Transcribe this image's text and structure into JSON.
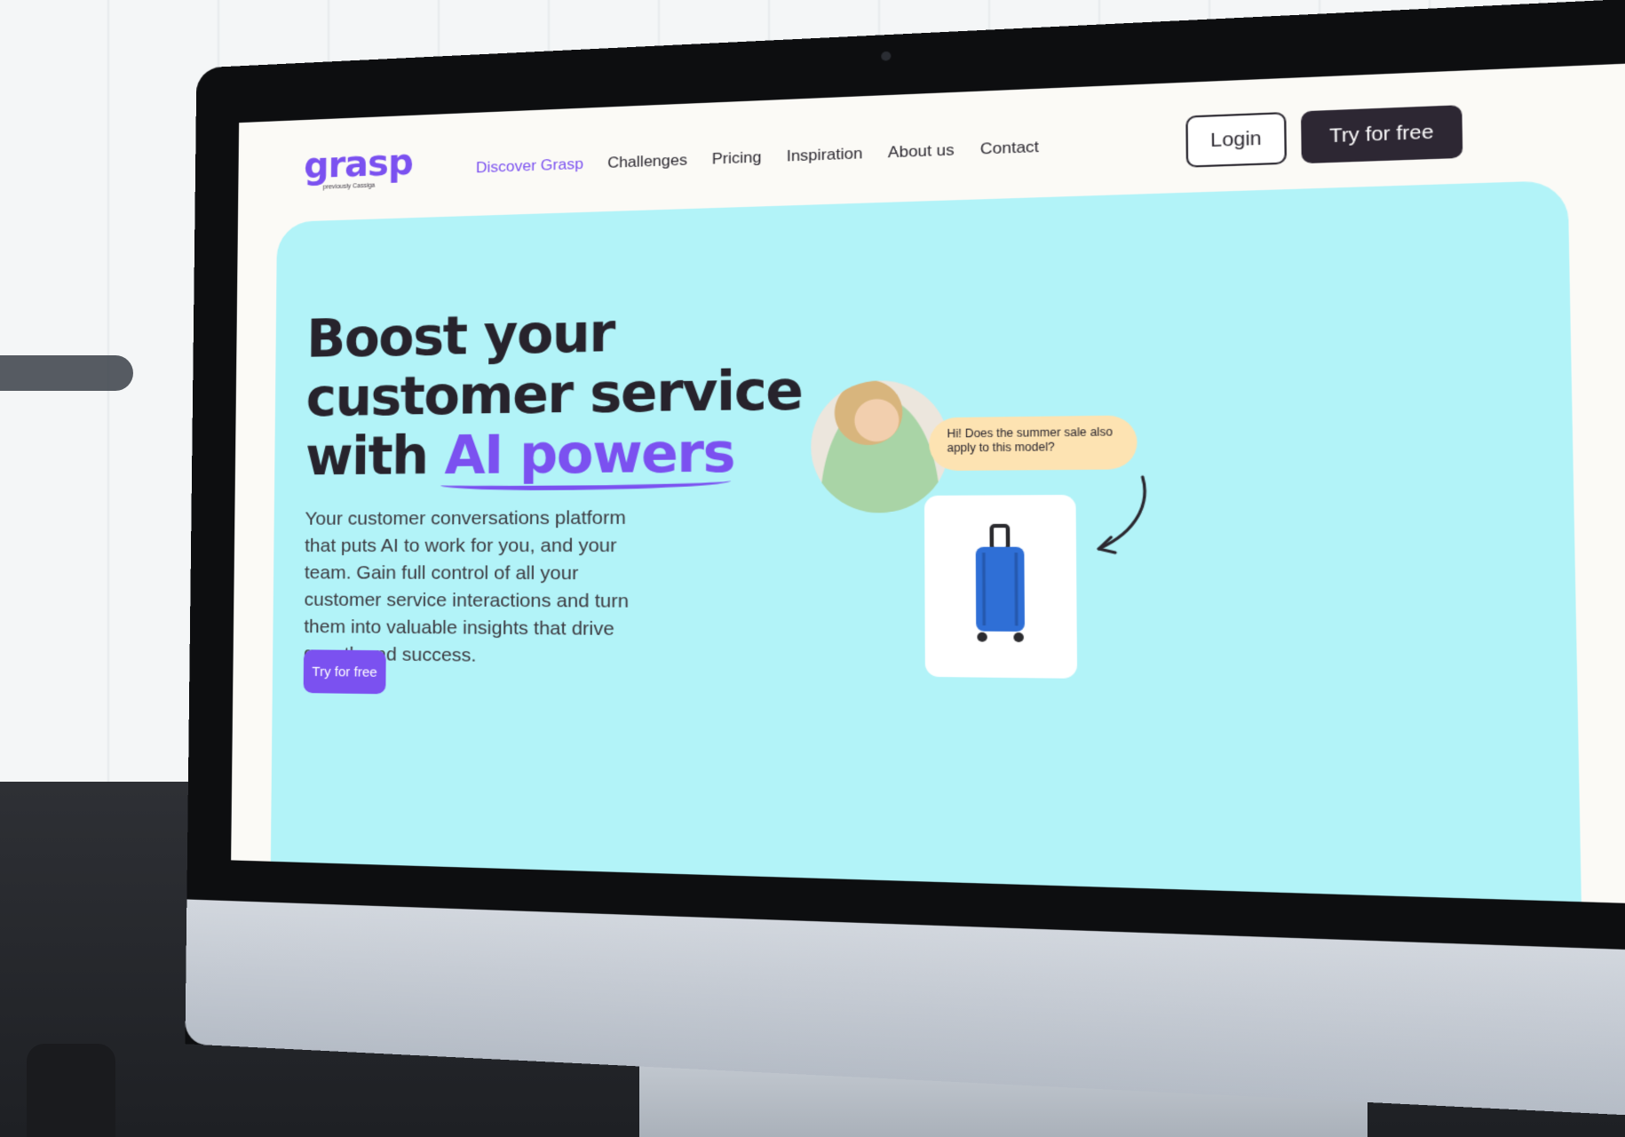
{
  "brand": {
    "logo_text": "grasp",
    "logo_tagline": "previously Cassiga",
    "accent_color": "#7b51f0",
    "hero_bg_color": "#b2f3f8"
  },
  "nav": {
    "links": [
      {
        "label": "Discover Grasp",
        "active": true
      },
      {
        "label": "Challenges",
        "active": false
      },
      {
        "label": "Pricing",
        "active": false
      },
      {
        "label": "Inspiration",
        "active": false
      },
      {
        "label": "About us",
        "active": false
      },
      {
        "label": "Contact",
        "active": false
      }
    ],
    "login_label": "Login",
    "try_label": "Try for free"
  },
  "hero": {
    "title_line1": "Boost your",
    "title_line2": "customer service",
    "title_line3_prefix": "with ",
    "title_highlight": "AI powers",
    "description": "Your customer conversations platform that puts AI to work for you, and your team. Gain full control of all your customer service interactions and turn them into valuable insights that drive growth and success.",
    "cta_label": "Try for free"
  },
  "illustration": {
    "chat_message": "Hi! Does the summer sale also apply to this model?",
    "avatar_icon": "woman-with-phone-photo",
    "product_icon": "blue-suitcase-icon",
    "arrow_icon": "curved-arrow-icon"
  }
}
